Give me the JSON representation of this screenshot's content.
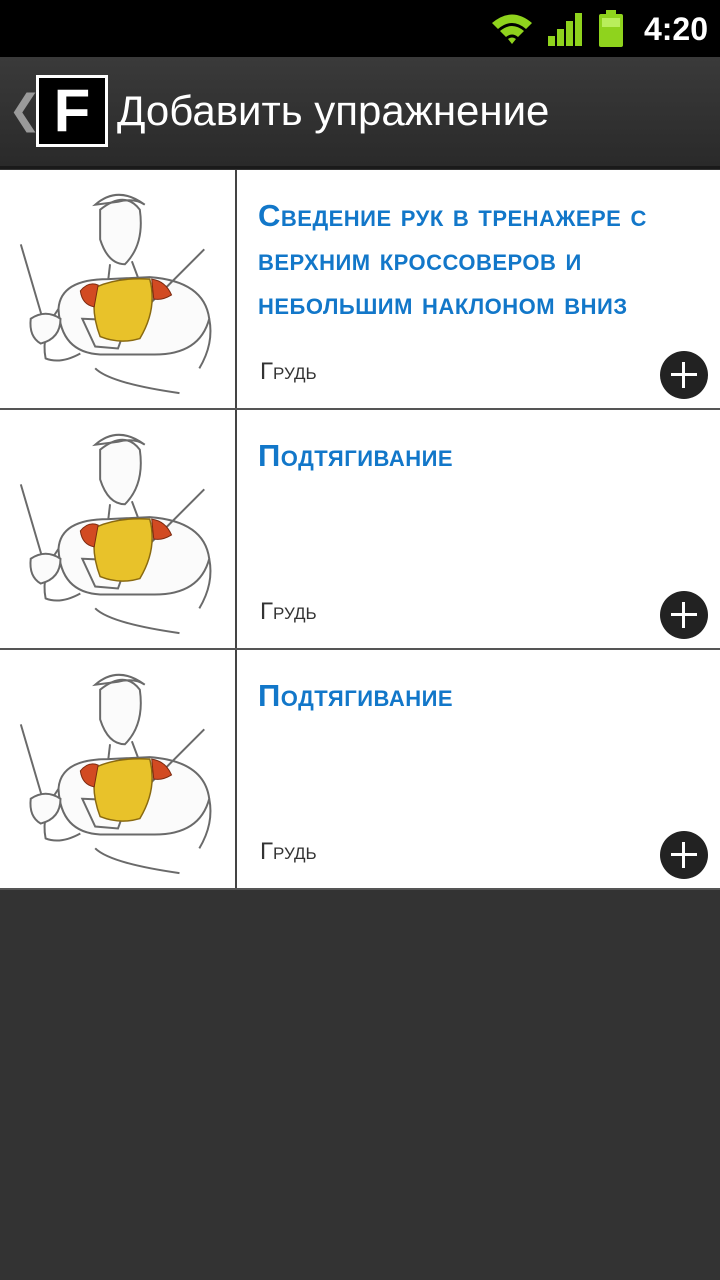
{
  "status_bar": {
    "time": "4:20",
    "icons": [
      "wifi-icon",
      "signal-icon",
      "battery-icon"
    ]
  },
  "action_bar": {
    "back_glyph": "❮",
    "logo_letter": "F",
    "title": "Добавить упражнение"
  },
  "exercises": [
    {
      "title": "Сведение рук в тренажере с верхним кроссоверов и небольшим наклоном вниз",
      "category": "Грудь"
    },
    {
      "title": "Подтягивание",
      "category": "Грудь"
    },
    {
      "title": "Подтягивание",
      "category": "Грудь"
    }
  ],
  "colors": {
    "accent": "#1277c9",
    "background": "#333333",
    "action_bar": "#2e2e2e"
  }
}
